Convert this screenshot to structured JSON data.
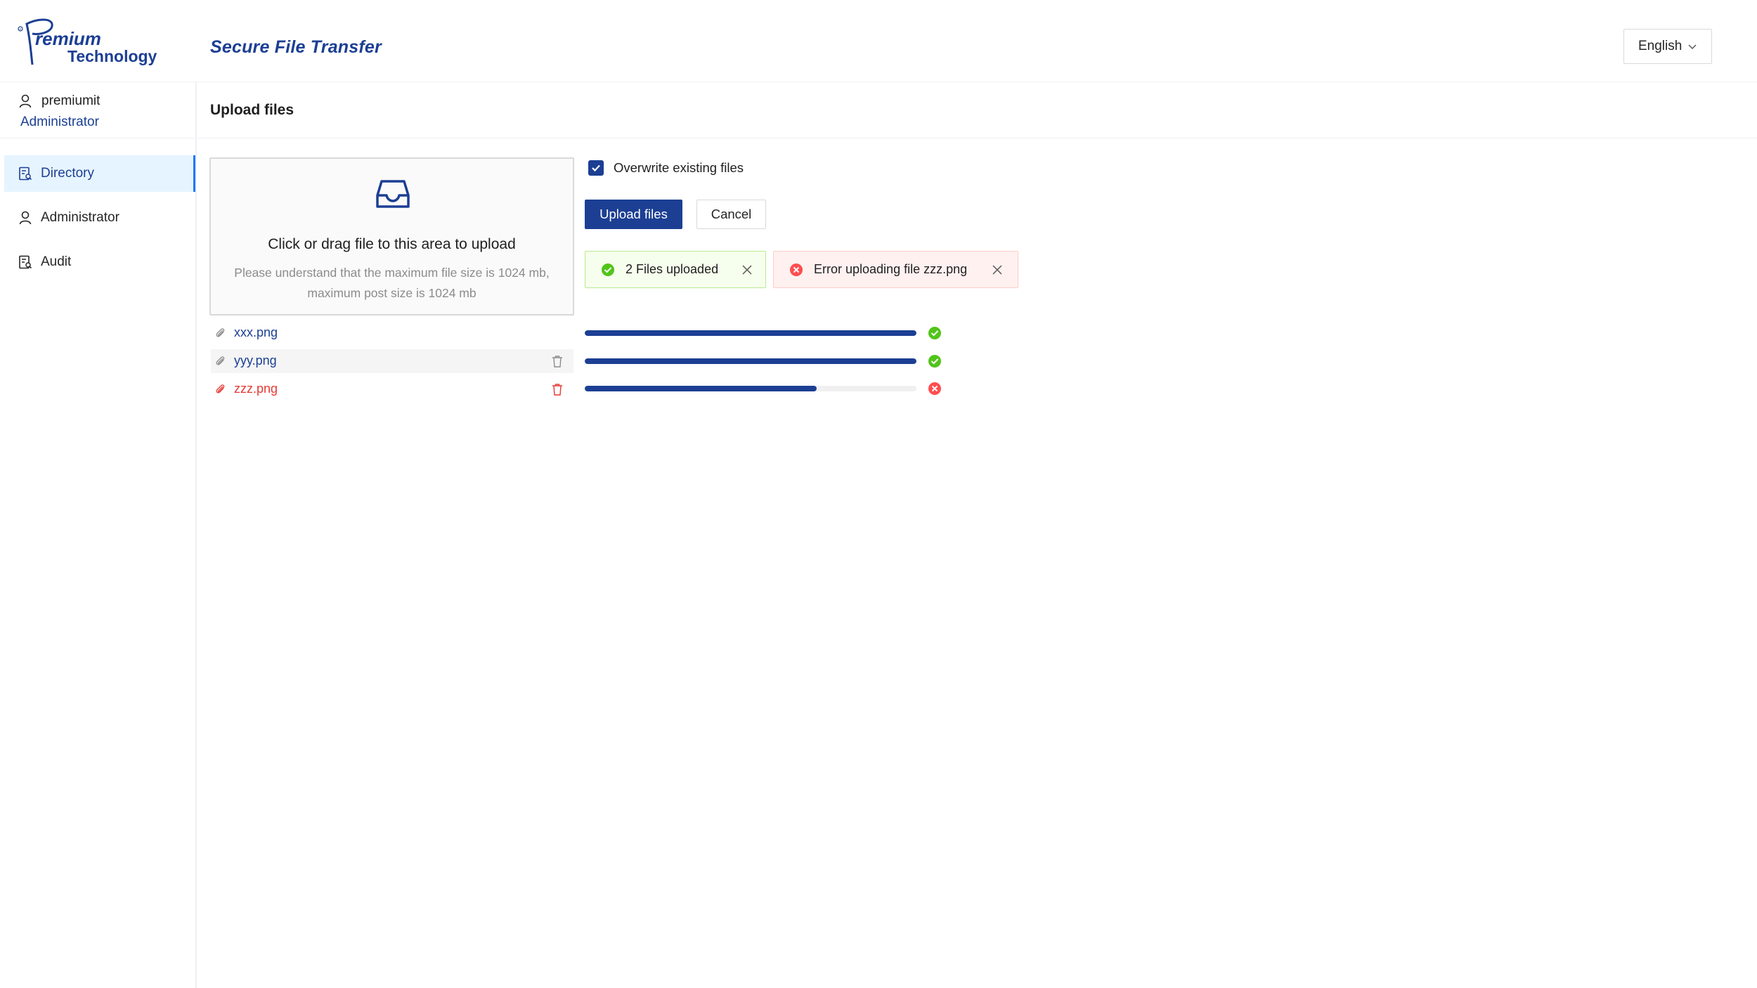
{
  "header": {
    "logo_text_line1": "remium",
    "logo_text_line2": "Technology",
    "app_title": "Secure File Transfer",
    "language": "English"
  },
  "sidebar": {
    "user": {
      "name": "premiumit",
      "role": "Administrator"
    },
    "items": [
      {
        "label": "Directory",
        "icon": "folder-doc-icon",
        "active": true
      },
      {
        "label": "Administrator",
        "icon": "user-icon",
        "active": false
      },
      {
        "label": "Audit",
        "icon": "audit-icon",
        "active": false
      }
    ]
  },
  "main": {
    "title": "Upload files",
    "dropzone": {
      "text": "Click or drag file to this area to upload",
      "hint": "Please understand that the maximum file size is 1024 mb, maximum post size is 1024 mb"
    },
    "overwrite": {
      "label": "Overwrite existing files",
      "checked": true
    },
    "buttons": {
      "upload": "Upload files",
      "cancel": "Cancel"
    },
    "alerts": {
      "success": "2 Files uploaded",
      "error": "Error uploading file zzz.png"
    },
    "files": [
      {
        "name": "xxx.png",
        "progress": 1.0,
        "status": "success"
      },
      {
        "name": "yyy.png",
        "progress": 1.0,
        "status": "success"
      },
      {
        "name": "zzz.png",
        "progress": 0.7,
        "status": "error"
      }
    ]
  },
  "colors": {
    "brand": "#1c3f94",
    "success": "#52c41a",
    "error": "#ff4d4f",
    "active_bg": "#e6f4ff"
  }
}
